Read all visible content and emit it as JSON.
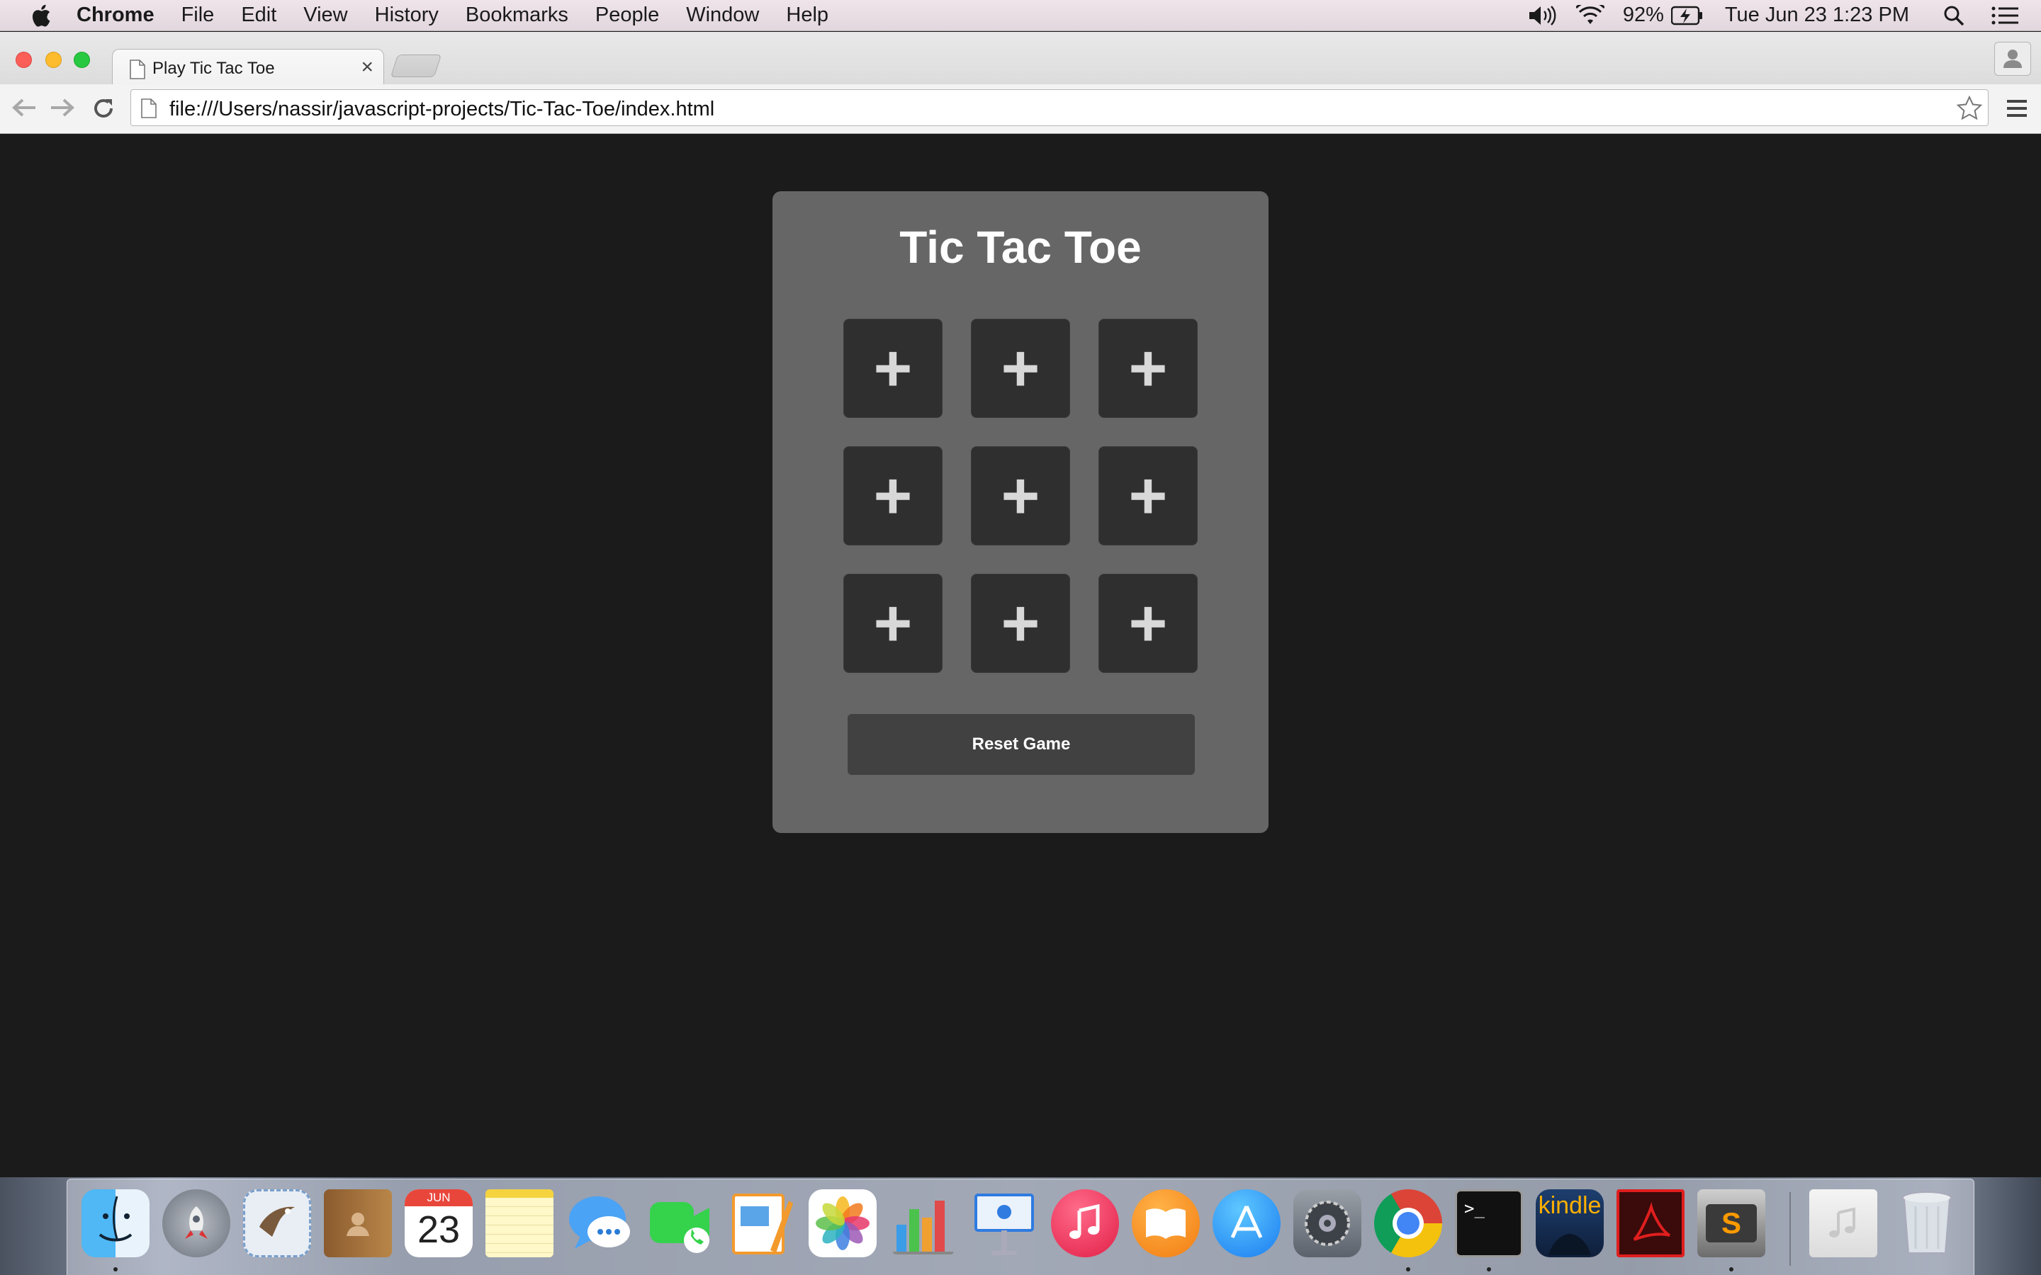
{
  "menubar": {
    "app_name": "Chrome",
    "menus": [
      "File",
      "Edit",
      "View",
      "History",
      "Bookmarks",
      "People",
      "Window",
      "Help"
    ],
    "battery_percent": "92%",
    "datetime": "Tue Jun 23  1:23 PM"
  },
  "browser": {
    "tab_title": "Play Tic Tac Toe",
    "url": "file:///Users/nassir/javascript-projects/Tic-Tac-Toe/index.html"
  },
  "game": {
    "title": "Tic Tac Toe",
    "cells": [
      "+",
      "+",
      "+",
      "+",
      "+",
      "+",
      "+",
      "+",
      "+"
    ],
    "reset_label": "Reset Game"
  },
  "dock": {
    "items": [
      "finder-icon",
      "launchpad-icon",
      "mail-icon",
      "contacts-icon",
      "calendar-icon",
      "notes-icon",
      "messages-icon",
      "facetime-icon",
      "pages-icon",
      "photos-icon",
      "numbers-icon",
      "keynote-icon",
      "itunes-icon",
      "ibooks-icon",
      "app-store-icon",
      "system-preferences-icon",
      "chrome-icon",
      "terminal-icon",
      "kindle-icon",
      "acrobat-icon",
      "sublime-text-icon",
      "music-folder-icon",
      "trash-icon"
    ],
    "calendar_month": "JUN",
    "calendar_day": "23",
    "kindle_label": "kindle",
    "sublime_letter": "S",
    "terminal_prompt": ">_"
  }
}
